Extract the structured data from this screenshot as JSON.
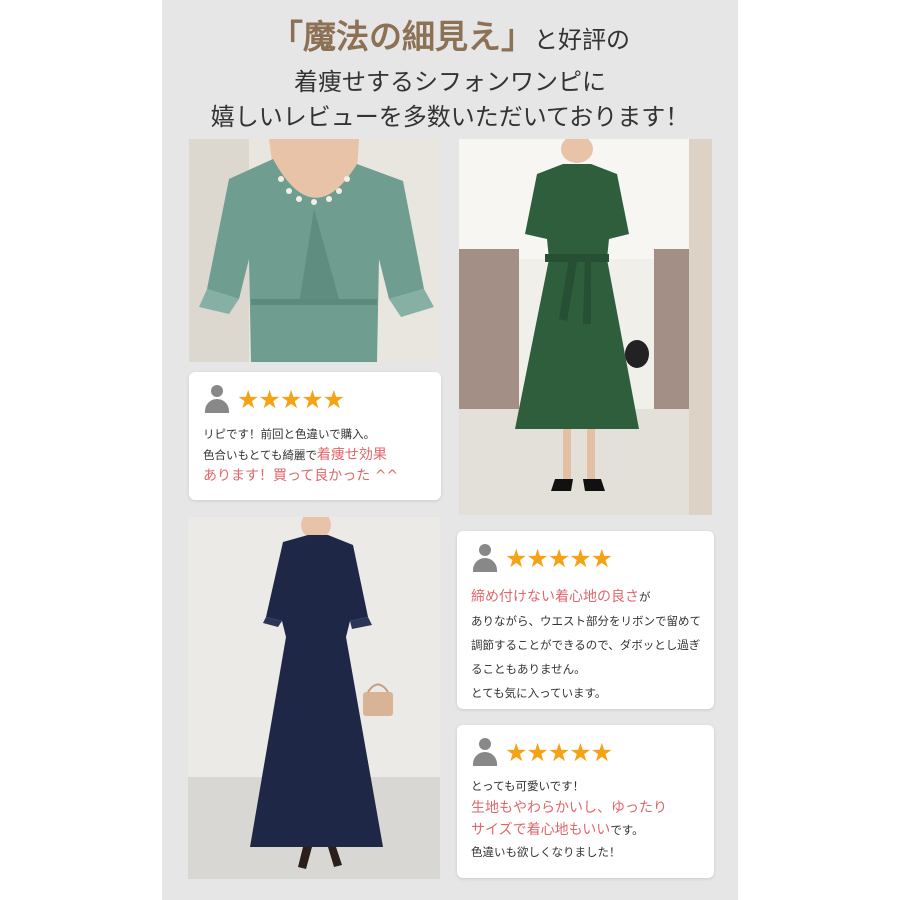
{
  "headline": {
    "line1_highlight": "「魔法の細見え」",
    "line1_rest": "と好評の",
    "line2": "着痩せするシフォンワンピに",
    "line3": "嬉しいレビューを多数いただいております！"
  },
  "photos": [
    {
      "name": "sage-green-dress-closeup",
      "color": "#6f9e91"
    },
    {
      "name": "forest-green-dress-full",
      "color": "#2f5e3c"
    },
    {
      "name": "navy-dress-full",
      "color": "#1e2746"
    }
  ],
  "colors": {
    "panel_bg": "#e6e6e6",
    "highlight_gold": "#8c7155",
    "star": "#f5a214",
    "pink_text": "#e0676b",
    "avatar": "#888888"
  },
  "reviews": [
    {
      "avatar_icon": "user-silhouette-icon",
      "stars": "★★★★★",
      "l1": "リピです！前回と色違いで購入。",
      "l2a": "色合いもとても綺麗で",
      "l2b": "着痩せ効果",
      "l3": "あります！買って良かった ^^"
    },
    {
      "avatar_icon": "user-silhouette-icon",
      "stars": "★★★★★",
      "l1a": "締め付けない着心地の良さ",
      "l1b": "が",
      "l2": "ありながら、ウエスト部分をリボンで留めて",
      "l3": "調節することができるので、ダボッとし過ぎ",
      "l4": "ることもありません。",
      "l5": "とても気に入っています。"
    },
    {
      "avatar_icon": "user-silhouette-icon",
      "stars": "★★★★★",
      "l1": "とっても可愛いです！",
      "l2": "生地もやわらかいし、ゆったり",
      "l3a": "サイズで着心地もいい",
      "l3b": "です。",
      "l4": "色違いも欲しくなりました！"
    }
  ]
}
